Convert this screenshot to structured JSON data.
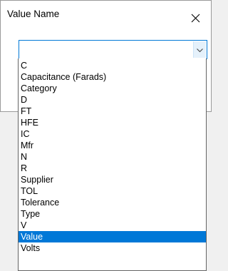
{
  "dialog": {
    "title": "Value Name"
  },
  "combo": {
    "value": ""
  },
  "dropdown": {
    "items": [
      {
        "label": "C",
        "selected": false
      },
      {
        "label": "Capacitance (Farads)",
        "selected": false
      },
      {
        "label": "Category",
        "selected": false
      },
      {
        "label": "D",
        "selected": false
      },
      {
        "label": "FT",
        "selected": false
      },
      {
        "label": "HFE",
        "selected": false
      },
      {
        "label": "IC",
        "selected": false
      },
      {
        "label": "Mfr",
        "selected": false
      },
      {
        "label": "N",
        "selected": false
      },
      {
        "label": "R",
        "selected": false
      },
      {
        "label": "Supplier",
        "selected": false
      },
      {
        "label": "TOL",
        "selected": false
      },
      {
        "label": "Tolerance",
        "selected": false
      },
      {
        "label": "Type",
        "selected": false
      },
      {
        "label": "V",
        "selected": false
      },
      {
        "label": "Value",
        "selected": true
      },
      {
        "label": "Volts",
        "selected": false
      }
    ],
    "highlight_color": "#0078d7"
  },
  "icons": {
    "close": "close-icon",
    "dropdown_arrow": "chevron-down-icon"
  }
}
